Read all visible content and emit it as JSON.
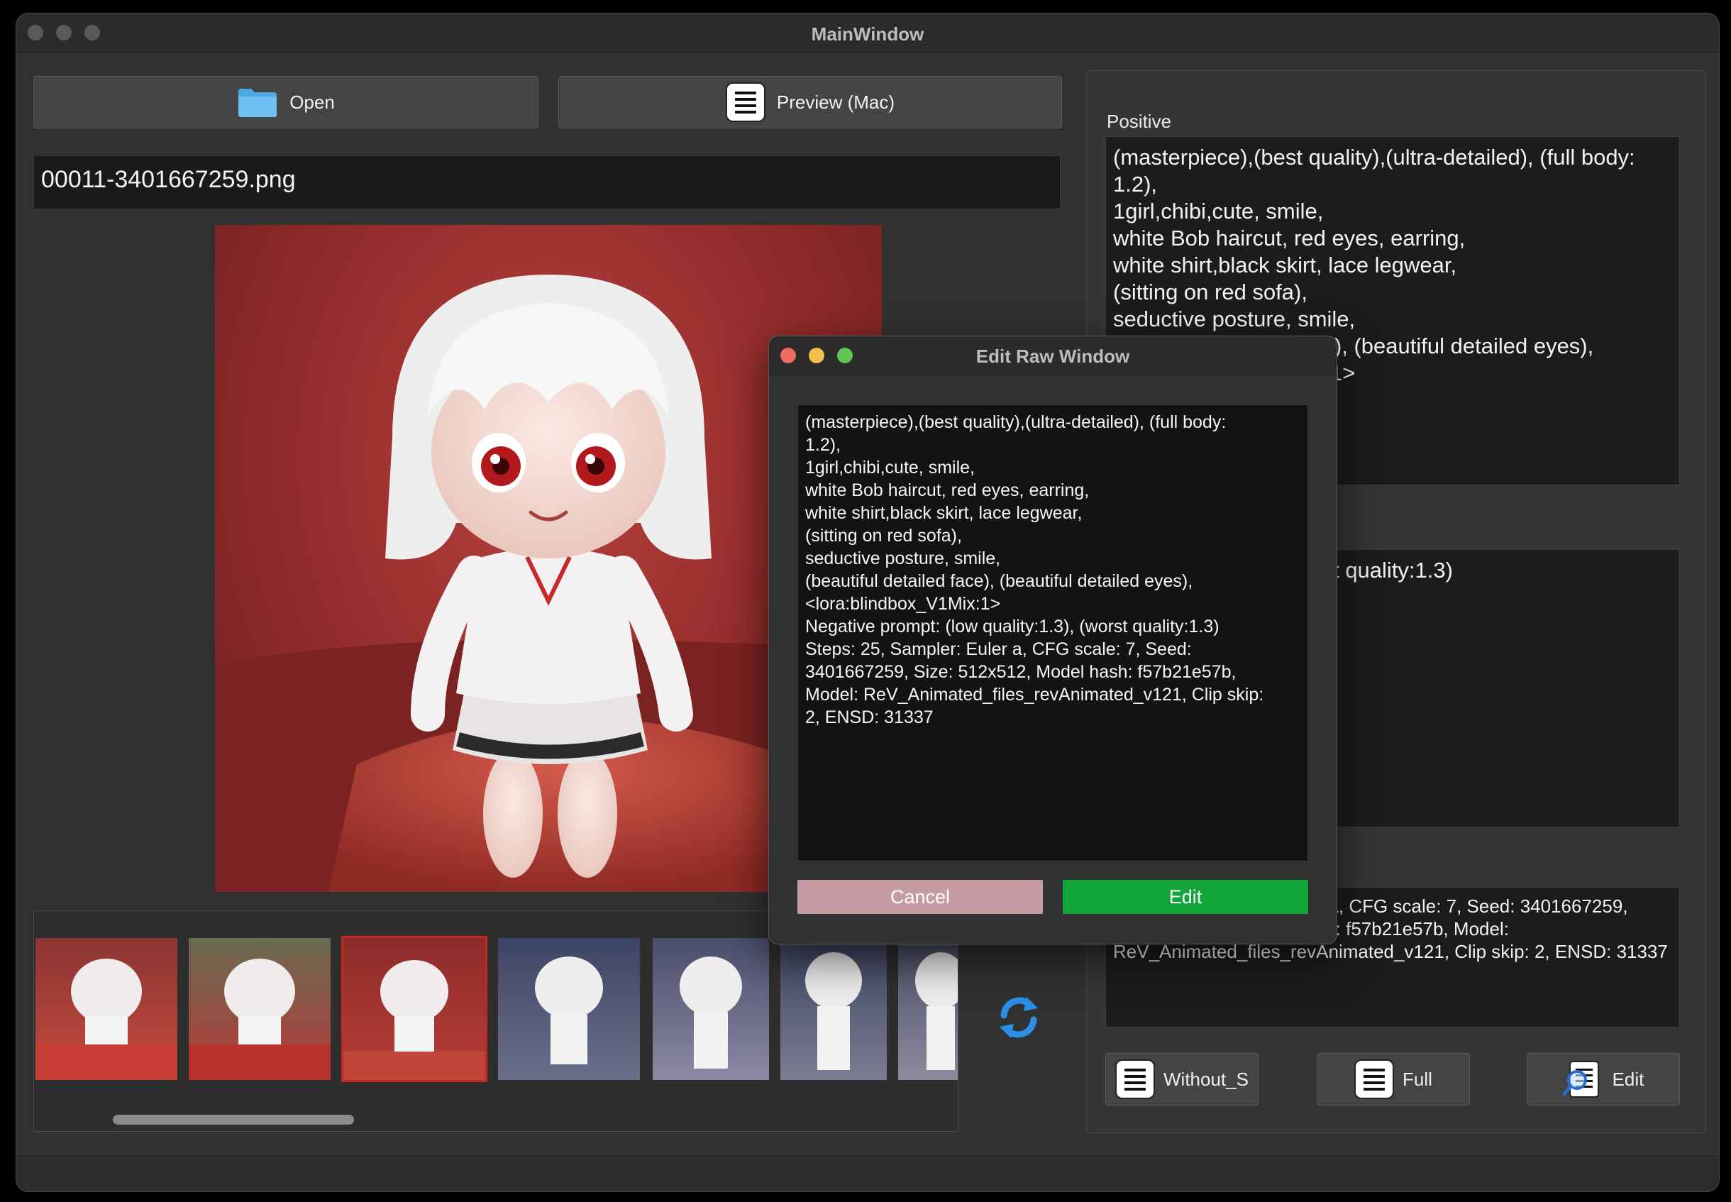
{
  "window": {
    "title": "MainWindow"
  },
  "toolbar": {
    "open_label": "Open",
    "preview_label": "Preview (Mac)"
  },
  "file": {
    "name": "00011-3401667259.png"
  },
  "right_panel": {
    "positive_label": "Positive",
    "positive_text": "(masterpiece),(best quality),(ultra-detailed), (full body: 1.2),\n1girl,chibi,cute, smile,\nwhite Bob haircut, red eyes, earring,\nwhite shirt,black skirt, lace legwear,\n(sitting on red sofa),\nseductive posture, smile,\n(beautiful detailed face), (beautiful detailed eyes),\n<lora:blindbox_V1Mix:1>",
    "negative_text": "(low quality:1.3), (worst quality:1.3)",
    "params_text": "Steps: 25, Sampler: Euler a, CFG scale: 7, Seed: 3401667259, Size: 512x512, Model hash: f57b21e57b, Model: ReV_Animated_files_revAnimated_v121, Clip skip: 2, ENSD: 31337",
    "without_label": "Without_S",
    "full_label": "Full",
    "edit_label": "Edit"
  },
  "dialog": {
    "title": "Edit Raw Window",
    "raw_text": "(masterpiece),(best quality),(ultra-detailed), (full body:\n1.2),\n1girl,chibi,cute, smile,\nwhite Bob haircut, red eyes, earring,\nwhite shirt,black skirt, lace legwear,\n(sitting on red sofa),\nseductive posture, smile,\n(beautiful detailed face), (beautiful detailed eyes),\n<lora:blindbox_V1Mix:1>\nNegative prompt: (low quality:1.3), (worst quality:1.3)\nSteps: 25, Sampler: Euler a, CFG scale: 7, Seed:\n3401667259, Size: 512x512, Model hash: f57b21e57b,\nModel: ReV_Animated_files_revAnimated_v121, Clip skip:\n2, ENSD: 31337",
    "cancel_label": "Cancel",
    "edit_label": "Edit"
  },
  "colors": {
    "cancel": "#c79ba3",
    "edit": "#13a53a",
    "thumb_selected": "#c8281f"
  },
  "icons": [
    "folder-icon",
    "document-icon",
    "refresh-icon",
    "document-search-icon"
  ]
}
